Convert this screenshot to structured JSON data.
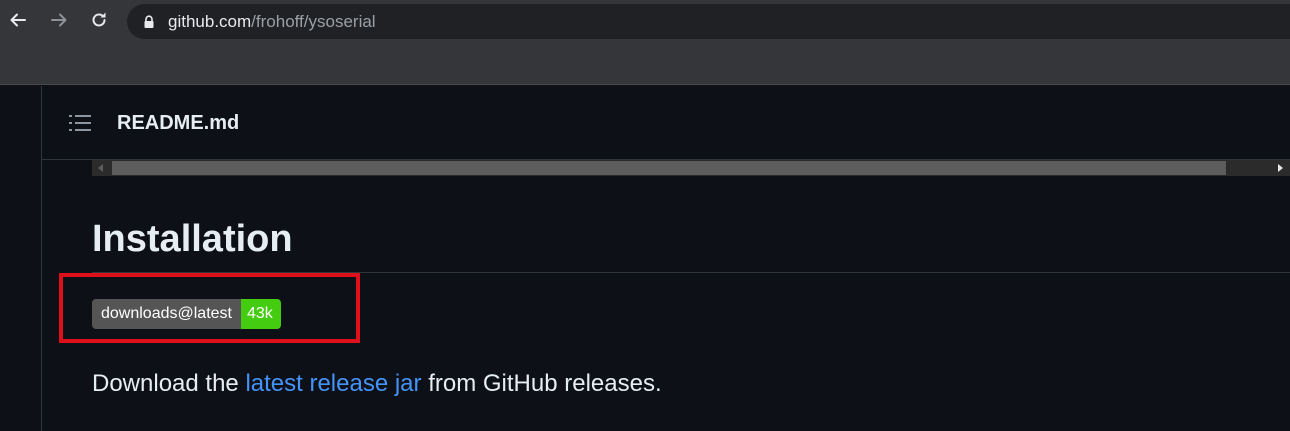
{
  "browser": {
    "url_host": "github.com",
    "url_path": "/frohoff/ysoserial",
    "back_icon": "arrow-left-icon",
    "forward_icon": "arrow-right-icon",
    "reload_icon": "reload-icon",
    "lock_icon": "lock-icon"
  },
  "readme": {
    "toc_icon": "list-icon",
    "title": "README.md"
  },
  "content": {
    "heading": "Installation",
    "badge": {
      "label": "downloads@latest",
      "value": "43k",
      "label_color": "#555555",
      "value_color": "#44cc11"
    },
    "paragraph": {
      "before": "Download the ",
      "link": "latest release jar",
      "after": " from GitHub releases."
    }
  },
  "colors": {
    "highlight_box": "#e0101b",
    "link": "#4493f8",
    "page_bg": "#0d1117"
  }
}
